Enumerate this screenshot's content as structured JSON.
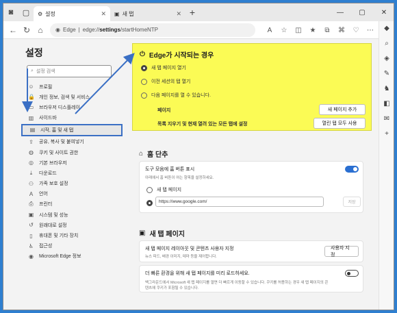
{
  "tabs": [
    {
      "label": "설정",
      "icon": "gear-icon"
    },
    {
      "label": "새 탭",
      "icon": "newtab-icon"
    }
  ],
  "address": {
    "prefix": "Edge",
    "separator": "|",
    "url_scheme": "edge://",
    "url_path": "settings",
    "url_rest": "/startHomeNTP"
  },
  "sidebar": {
    "title": "설정",
    "search_placeholder": "설정 검색",
    "items": [
      {
        "label": "프로필",
        "icon": "profile-icon"
      },
      {
        "label": "개인 정보, 검색 및 서비스",
        "icon": "lock-icon"
      },
      {
        "label": "브라우저 디스플레이",
        "icon": "display-icon"
      },
      {
        "label": "사이드바",
        "icon": "sidebar-icon"
      },
      {
        "label": "시작, 홈 및 새 탭",
        "icon": "start-icon",
        "active": true
      },
      {
        "label": "공유, 복사 및 붙여넣기",
        "icon": "share-icon"
      },
      {
        "label": "쿠키 및 사이트 권한",
        "icon": "cookie-icon"
      },
      {
        "label": "기본 브라우저",
        "icon": "browser-icon"
      },
      {
        "label": "다운로드",
        "icon": "download-icon"
      },
      {
        "label": "가족 보호 설정",
        "icon": "family-icon"
      },
      {
        "label": "언어",
        "icon": "language-icon"
      },
      {
        "label": "프린터",
        "icon": "printer-icon"
      },
      {
        "label": "시스템 및 성능",
        "icon": "system-icon"
      },
      {
        "label": "원래대로 설정",
        "icon": "reset-icon"
      },
      {
        "label": "휴대폰 및 기타 장치",
        "icon": "phone-icon"
      },
      {
        "label": "접근성",
        "icon": "accessibility-icon"
      },
      {
        "label": "Microsoft Edge 정보",
        "icon": "edge-icon"
      }
    ]
  },
  "startup": {
    "title": "Edge가 시작되는 경우",
    "options": [
      "새 탭 페이지 열기",
      "이전 세션의 탭 열기",
      "다음 페이지를 열 수 있습니다."
    ],
    "selected_index": 0,
    "pages_label": "페이지",
    "add_page_button": "새 페이지 추가",
    "clear_desc": "목록 지우기 및 현재 열려 있는 모든 탭에 설정",
    "use_all_tabs_button": "열린 탭 모두 사용"
  },
  "home": {
    "title": "홈 단추",
    "show_button_label": "도구 모음에 홈 버튼 표시",
    "show_button_desc": "아래에서 홈 버튼이 여는 항목을 설정하세요.",
    "show_button_on": true,
    "option_newtab": "새 탭 페이지",
    "url_value": "https://www.google.com/",
    "save_button": "저장"
  },
  "newtab": {
    "title": "새 탭 페이지",
    "customize_label": "새 탭 페이지 레이아웃 및 콘텐츠 사용자 지정",
    "customize_desc": "뉴스 피드, 배경 이미지, 테마 등을 제어합니다.",
    "customize_button": "사용자 지정",
    "preload_label": "더 빠른 환경을 위해 새 탭 페이지를 미리 로드하세요.",
    "preload_desc_1": "백그라운드에서 Microsoft 새 탭 페이지를 열면 더 빠르게 이동할 수 있습니다. 쿠키를 허용하는 경우 새 탭 페이지의 콘",
    "preload_desc_2": "텐츠에 쿠키가 포함될 수 있습니다.",
    "preload_on": false
  },
  "colors": {
    "accent": "#2a6fd1",
    "highlight": "#fbfb55",
    "annotation": "#3a6fc4",
    "desktop": "#2f7fd0"
  }
}
